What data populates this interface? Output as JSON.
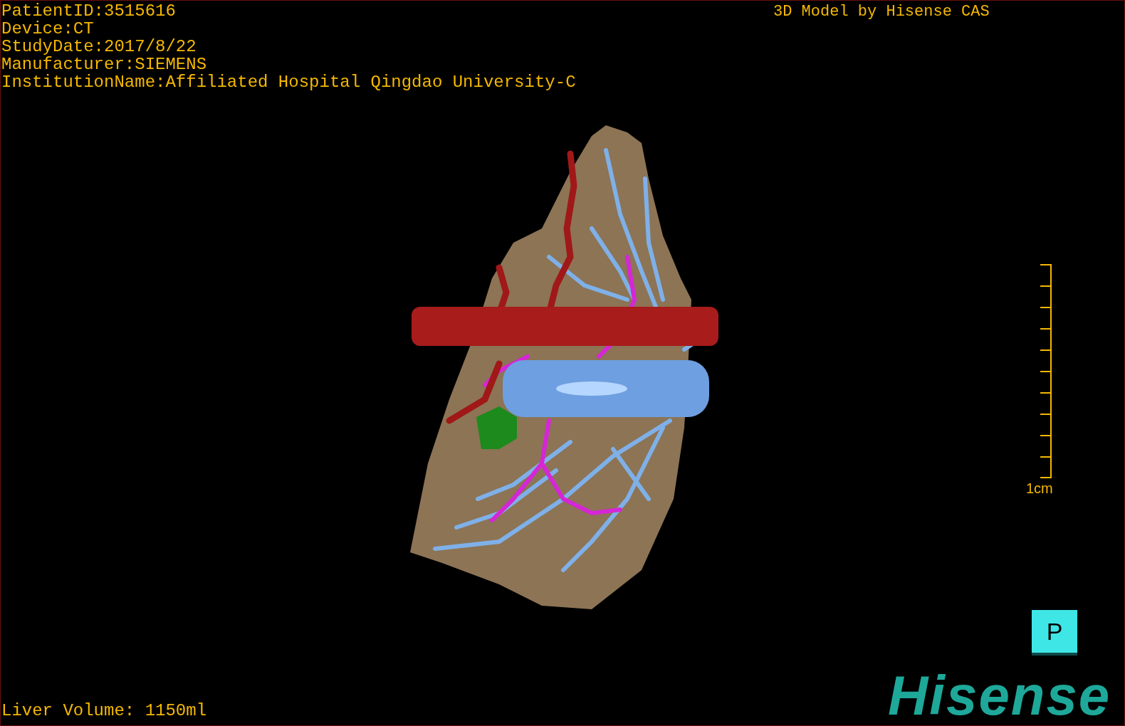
{
  "info_lines": [
    "PatientID:3515616",
    "Device:CT",
    "StudyDate:2017/8/22",
    "Manufacturer:SIEMENS",
    "InstitutionName:Affiliated Hospital Qingdao University-C"
  ],
  "model_credit": "3D Model by Hisense CAS",
  "scale_bar": {
    "label": "1cm"
  },
  "orientation_cube": {
    "label": "P"
  },
  "liver_volume": "Liver Volume: 1150ml",
  "logo": "Hisense"
}
